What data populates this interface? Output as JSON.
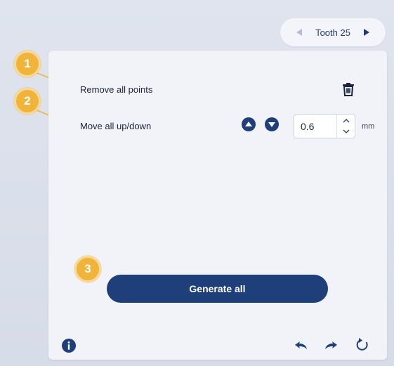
{
  "tooth_nav": {
    "label": "Tooth 25",
    "prev_icon": "triangle-left-icon",
    "next_icon": "triangle-right-icon"
  },
  "rows": {
    "remove_all": {
      "label": "Remove all points",
      "icon": "trash-icon"
    },
    "move_all": {
      "label": "Move all up/down",
      "up_icon": "circle-arrow-up-icon",
      "down_icon": "circle-arrow-down-icon",
      "value": "0.6",
      "unit": "mm"
    }
  },
  "generate_button": {
    "label": "Generate all"
  },
  "footer": {
    "info_icon": "info-icon",
    "undo_icon": "undo-icon",
    "redo_icon": "redo-icon",
    "reset_icon": "refresh-icon"
  },
  "callouts": [
    "1",
    "2",
    "3"
  ],
  "colors": {
    "primary": "#1f3f7a",
    "callout": "#f0b43a",
    "panel": "#f1f3f8",
    "background": "#dfe4ee"
  }
}
